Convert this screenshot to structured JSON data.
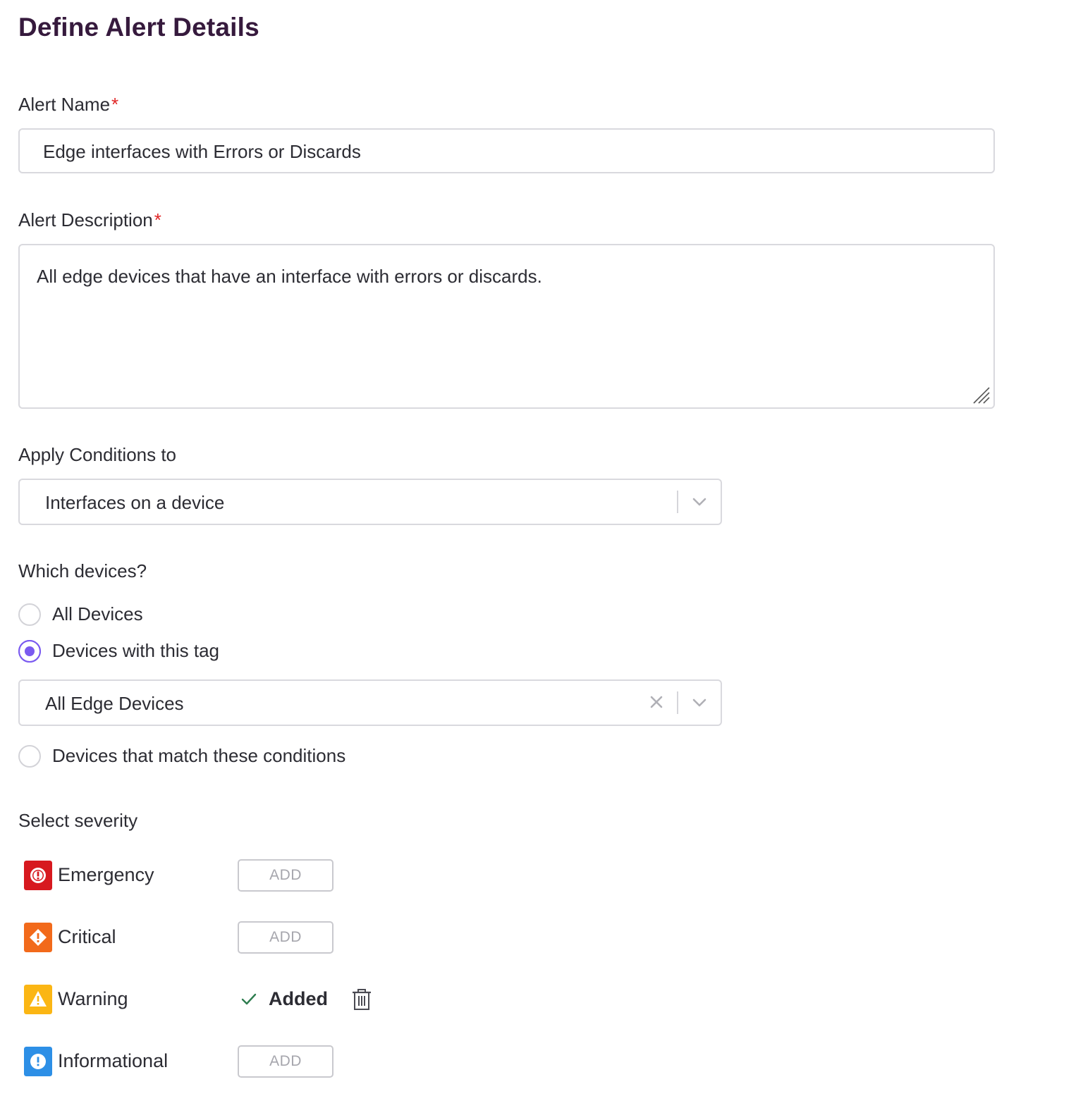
{
  "page": {
    "title": "Define Alert Details"
  },
  "alert_name": {
    "label": "Alert Name",
    "required_mark": "*",
    "value": "Edge interfaces with Errors or Discards"
  },
  "alert_description": {
    "label": "Alert Description",
    "required_mark": "*",
    "value": "All edge devices that have an interface with errors or discards."
  },
  "apply_conditions": {
    "label": "Apply Conditions to",
    "selected": "Interfaces on a device"
  },
  "which_devices": {
    "label": "Which devices?",
    "options": [
      {
        "label": "All Devices",
        "selected": false
      },
      {
        "label": "Devices with this tag",
        "selected": true
      },
      {
        "label": "Devices that match these conditions",
        "selected": false
      }
    ],
    "tag_selected": "All Edge Devices"
  },
  "severity": {
    "label": "Select severity",
    "items": [
      {
        "name": "Emergency",
        "icon": "emergency-icon",
        "color": "#d7191f",
        "state": "ADD"
      },
      {
        "name": "Critical",
        "icon": "critical-icon",
        "color": "#f26a1b",
        "state": "ADD"
      },
      {
        "name": "Warning",
        "icon": "warning-icon",
        "color": "#fbb614",
        "state": "Added"
      },
      {
        "name": "Informational",
        "icon": "info-icon",
        "color": "#2d8fe6",
        "state": "ADD"
      }
    ]
  },
  "colors": {
    "title": "#361a3d",
    "required": "#e02424",
    "radio_accent": "#7a5af0",
    "added_check": "#2e7d4f"
  }
}
